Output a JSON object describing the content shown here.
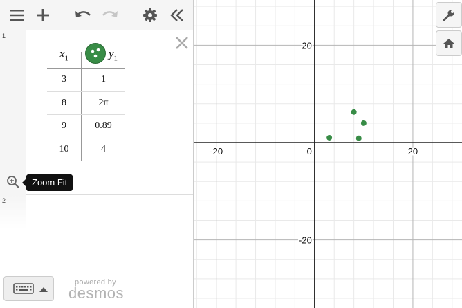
{
  "expressions": [
    {
      "line_number": "1",
      "type": "table",
      "columns": {
        "x_var": "x",
        "x_sub": "1",
        "y_var": "y",
        "y_sub": "1"
      },
      "rows": [
        {
          "x": "3",
          "y": "1"
        },
        {
          "x": "8",
          "y": "2π"
        },
        {
          "x": "9",
          "y": "0.89"
        },
        {
          "x": "10",
          "y": "4"
        }
      ],
      "color": "#388c46"
    },
    {
      "line_number": "2",
      "type": "empty"
    }
  ],
  "tooltip": {
    "zoom_fit": "Zoom Fit"
  },
  "branding": {
    "powered_by": "powered by",
    "name": "desmos"
  },
  "chart_data": {
    "type": "scatter",
    "points": [
      {
        "x": 3,
        "y": 1
      },
      {
        "x": 8,
        "y": 6.283
      },
      {
        "x": 9,
        "y": 0.89
      },
      {
        "x": 10,
        "y": 4
      }
    ],
    "xlim": [
      -24.6,
      30
    ],
    "ylim": [
      -34,
      29.3
    ],
    "major_step": 20,
    "minor_step": 4,
    "x_ticks": [
      "-20",
      "0",
      "20"
    ],
    "y_ticks": [
      "20",
      "-20"
    ],
    "grid": true,
    "point_color": "#388c46"
  }
}
